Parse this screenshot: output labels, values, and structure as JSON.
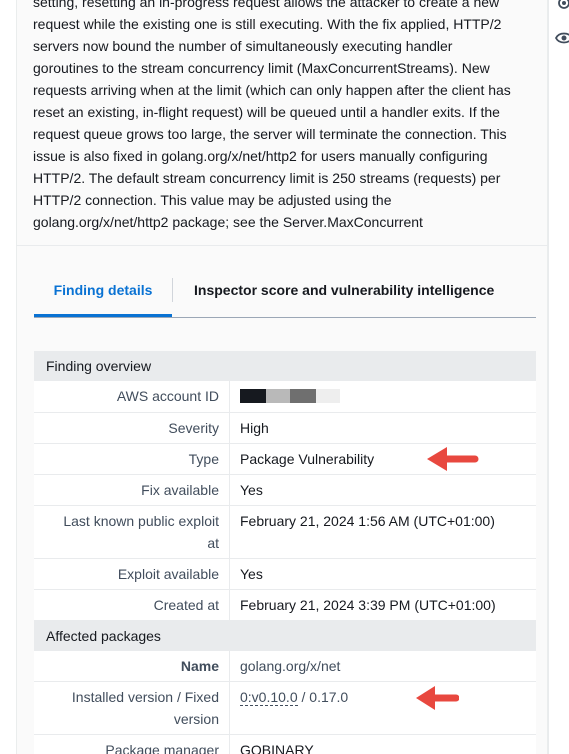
{
  "description": {
    "lines": [
      "setting, resetting an in-progress request allows the attacker to create a new",
      "request while the existing one is still executing. With the fix applied, HTTP/2",
      "servers now bound the number of simultaneously executing handler",
      "goroutines to the stream concurrency limit (MaxConcurrentStreams). New",
      "requests arriving when at the limit (which can only happen after the client has",
      "reset an existing, in-flight request) will be queued until a handler exits. If the",
      "request queue grows too large, the server will terminate the connection. This",
      "issue is also fixed in golang.org/x/net/http2 for users manually configuring",
      "HTTP/2. The default stream concurrency limit is 250 streams (requests) per",
      "HTTP/2 connection. This value may be adjusted using the",
      "golang.org/x/net/http2 package; see the Server.MaxConcurrent"
    ]
  },
  "tabs": [
    {
      "label": "Finding details",
      "active": true
    },
    {
      "label": "Inspector score and vulnerability intelligence",
      "active": false
    }
  ],
  "finding_overview": {
    "title": "Finding overview",
    "account_label": "AWS account ID",
    "severity_label": "Severity",
    "severity_value": "High",
    "type_label": "Type",
    "type_value": "Package Vulnerability",
    "fix_label": "Fix available",
    "fix_value": "Yes",
    "exploit_public_label_1": "Last known public exploit",
    "exploit_public_label_2": "at",
    "exploit_public_value": "February 21, 2024 1:56 AM (UTC+01:00)",
    "exploit_available_label": "Exploit available",
    "exploit_available_value": "Yes",
    "created_label": "Created at",
    "created_value": "February 21, 2024 3:39 PM (UTC+01:00)"
  },
  "affected_packages": {
    "title": "Affected packages",
    "name_label": "Name",
    "name_value": "golang.org/x/net",
    "version_label_1": "Installed version / Fixed",
    "version_label_2": "version",
    "installed_version": "0:v0.10.0",
    "version_separator": " / ",
    "fixed_version": "0.17.0",
    "manager_label": "Package manager",
    "manager_value": "GOBINARY"
  },
  "colors": {
    "accent": "#0972d3",
    "annotation_arrow": "#e8483f",
    "redaction_dark": "#16191f",
    "redaction_light": "#b9b9b9",
    "redaction_mid": "#6f6f6f",
    "redaction_pale": "#eeeeee"
  },
  "icons": [
    "gear-icon",
    "eye-icon",
    "annotation-arrow"
  ]
}
